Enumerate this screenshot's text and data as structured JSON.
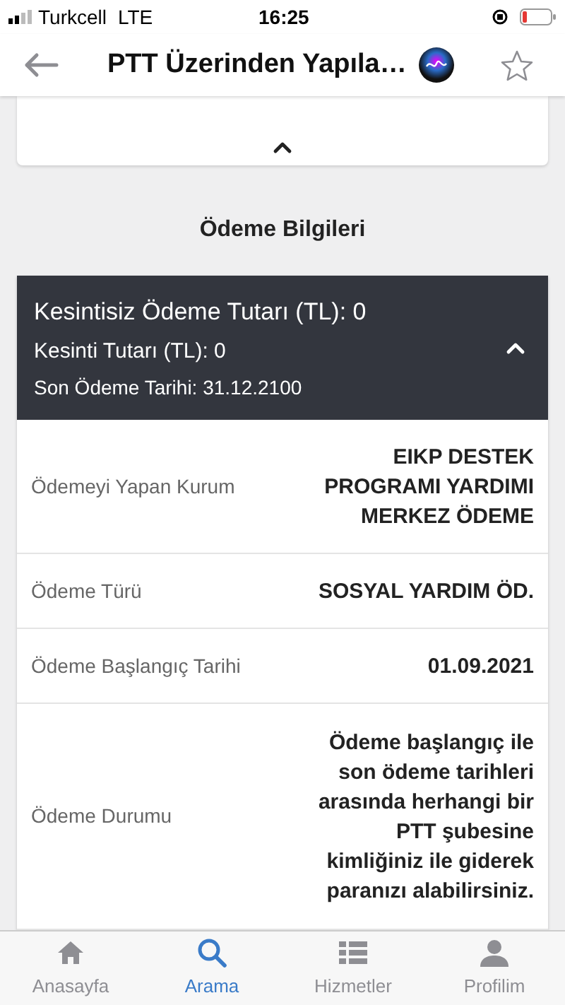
{
  "status_bar": {
    "carrier": "Turkcell",
    "network": "LTE",
    "time": "16:25"
  },
  "nav": {
    "title": "PTT Üzerinden Yapıla…"
  },
  "section_title": "Ödeme Bilgileri",
  "summary": {
    "expanded": true,
    "lines": [
      "Kesintisiz Ödeme Tutarı (TL): 0",
      "Kesinti Tutarı (TL): 0",
      "Son Ödeme Tarihi: 31.12.2100"
    ]
  },
  "details": [
    {
      "label": "Ödemeyi Yapan Kurum",
      "value": "EIKP DESTEK PROGRAMI YARDIMI MERKEZ ÖDEME"
    },
    {
      "label": "Ödeme Türü",
      "value": "SOSYAL YARDIM ÖD."
    },
    {
      "label": "Ödeme Başlangıç Tarihi",
      "value": "01.09.2021"
    },
    {
      "label": "Ödeme Durumu",
      "value": "Ödeme başlangıç ile son ödeme tarihleri arasında herhangi bir PTT şubesine kimliğiniz ile giderek paranızı alabilirsiniz."
    }
  ],
  "tabs": [
    {
      "label": "Anasayfa",
      "selected": false,
      "kind": "home"
    },
    {
      "label": "Arama",
      "selected": true,
      "kind": "search"
    },
    {
      "label": "Hizmetler",
      "selected": false,
      "kind": "list"
    },
    {
      "label": "Profilim",
      "selected": false,
      "kind": "profile"
    }
  ]
}
